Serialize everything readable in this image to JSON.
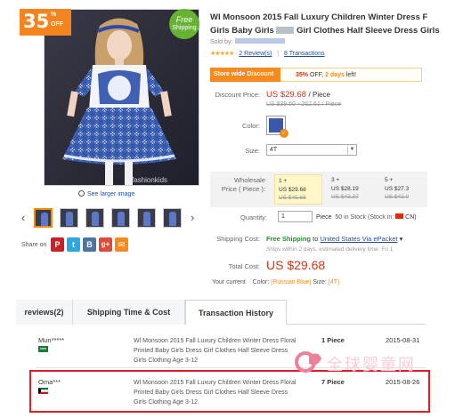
{
  "discount_tag": {
    "value": "35",
    "percent": "%",
    "off": "OFF"
  },
  "free_shipping_badge": {
    "line1": "Free",
    "line2": "Shipping"
  },
  "photo_watermark": "fashionkids",
  "see_larger": "See larger image",
  "share": {
    "label": "Share on",
    "buttons": [
      {
        "icon": "pinterest-icon",
        "glyph": "P",
        "color": "#cb2027"
      },
      {
        "icon": "twitter-icon",
        "glyph": "t",
        "color": "#2aa9e0"
      },
      {
        "icon": "vk-icon",
        "glyph": "B",
        "color": "#4c75a3"
      },
      {
        "icon": "google-plus-icon",
        "glyph": "g+",
        "color": "#dd4b39"
      },
      {
        "icon": "email-icon",
        "glyph": "✉",
        "color": "#f58b1f"
      }
    ]
  },
  "product": {
    "title_line1": "Wl Monsoon 2015 Fall Luxury Children Winter Dress F",
    "title_line2_a": "Girls Baby Girls",
    "title_line2_b": "Girl Clothes Half Sleeve Dress Girls Cloth",
    "sold_by": "Sold by:",
    "rating_stars": "★★★★★",
    "reviews": "2 Review(s)",
    "transactions": "8 Transactions"
  },
  "store_discount": {
    "tag": "Store wide Discount",
    "pct": "35%",
    "off_text": "OFF,",
    "days": "2 days",
    "left": "left!"
  },
  "labels": {
    "discount_price": "Discount Price:",
    "color": "Color:",
    "size": "Size:",
    "wholesale_1": "Wholesale",
    "wholesale_2": "Price ( Piece ):",
    "quantity": "Quantity:",
    "shipping_cost": "Shipping Cost:",
    "total_cost": "Total Cost:",
    "your_current": "Your current"
  },
  "price": {
    "discount": "US $29.68",
    "unit": "/ Piece",
    "original": "US $39.60 - 262.61 / Piece"
  },
  "size": {
    "selected": "4T"
  },
  "wholesale_tiers": [
    {
      "qty": "1 +",
      "price": "US $29.68",
      "old": "US $45.68"
    },
    {
      "qty": "3 +",
      "price": "US $28.19",
      "old": "US $43.37"
    },
    {
      "qty": "5 +",
      "price": "US $27.3",
      "old": "US $42.0"
    }
  ],
  "quantity": {
    "value": "1",
    "unit": "Piece",
    "stock": "50 in Stock (Stock in:",
    "country": "CN)"
  },
  "shipping": {
    "free": "Free Shipping",
    "to": "to",
    "via": "United States Via ePacket",
    "note": "Ships within 2 days, estimated delivery time: Fri 1"
  },
  "total": "US $29.68",
  "current_selection": {
    "prefix": "Color:",
    "color": "[Russian Blue]",
    "size_lbl": "Size:",
    "size": "[4T]"
  },
  "tabs": [
    {
      "label": "reviews(2)",
      "active": false
    },
    {
      "label": "Shipping Time & Cost",
      "active": false
    },
    {
      "label": "Transaction History",
      "active": true
    }
  ],
  "transactions": [
    {
      "buyer": "Mun*****",
      "flag": "saudi-arabia",
      "desc_line1": "Wl Monsoon 2015 Fall Luxury Children Winter Dress Floral",
      "desc_line2": "Printed Baby Girls Dress Girl Clothes Half Sleeve Dress",
      "desc_line3": "Girls Clothing Age 3-12",
      "qty": "1 Piece",
      "date": "2015-08-31"
    },
    {
      "buyer": "Oma***",
      "flag": "kuwait",
      "desc_line1": "Wl Monsoon 2015 Fall Luxury Children Winter Dress Floral",
      "desc_line2": "Printed Baby Girls Dress Girl Clothes Half Sleeve Dress",
      "desc_line3": "Girls Clothing Age 3-12",
      "qty": "7 Piece",
      "date": "2015-08-26"
    }
  ],
  "watermark": {
    "text": "全球婴童网"
  }
}
